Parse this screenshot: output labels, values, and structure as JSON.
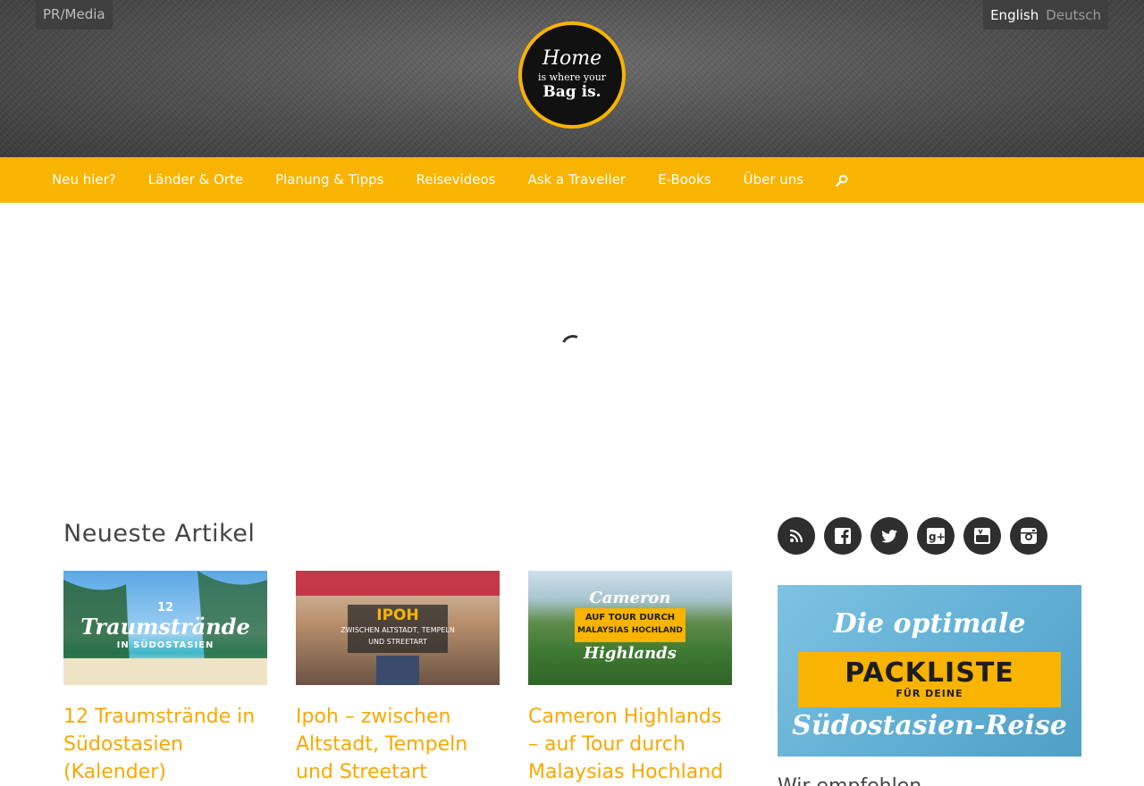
{
  "topbar": {
    "pr_link": "PR/Media",
    "languages": [
      {
        "label": "English",
        "active": true
      },
      {
        "label": "Deutsch",
        "active": false
      }
    ]
  },
  "logo": {
    "line1": "Home",
    "line2": "is where your",
    "line3": "Bag is."
  },
  "nav": {
    "items": [
      {
        "label": "Neu hier?"
      },
      {
        "label": "Länder & Orte"
      },
      {
        "label": "Planung & Tipps"
      },
      {
        "label": "Reisevideos"
      },
      {
        "label": "Ask a Traveller"
      },
      {
        "label": "E-Books"
      },
      {
        "label": "Über uns"
      }
    ],
    "search_icon": "search-icon"
  },
  "main": {
    "section_title": "Neueste Artikel",
    "articles": [
      {
        "title": "12 Traumstrände in Südostasien (Kalender)",
        "thumb_line1": "12",
        "thumb_line2": "Traumstrände",
        "thumb_line3": "IN SÜDOSTASIEN"
      },
      {
        "title": "Ipoh – zwischen Altstadt, Tempeln und Streetart",
        "thumb_line1": "IPOH",
        "thumb_line2": "ZWISCHEN ALTSTADT, TEMPELN",
        "thumb_line3": "UND STREETART"
      },
      {
        "title": "Cameron Highlands – auf Tour durch Malaysias Hochland",
        "thumb_line1": "Cameron",
        "thumb_line2": "AUF TOUR DURCH",
        "thumb_line3": "MALAYSIAS HOCHLAND",
        "thumb_line4": "Highlands"
      }
    ]
  },
  "sidebar": {
    "social": [
      "rss-icon",
      "facebook-icon",
      "twitter-icon",
      "google-plus-icon",
      "youtube-icon",
      "instagram-icon"
    ],
    "banner": {
      "line1": "Die optimale",
      "line2": "PACKLISTE",
      "line3": "FÜR DEINE",
      "line4": "Südostasien-Reise"
    },
    "heading": "Wir empfehlen"
  },
  "colors": {
    "accent": "#f8b400",
    "link": "#f8a800",
    "header_bg": "#4e4e4e"
  }
}
